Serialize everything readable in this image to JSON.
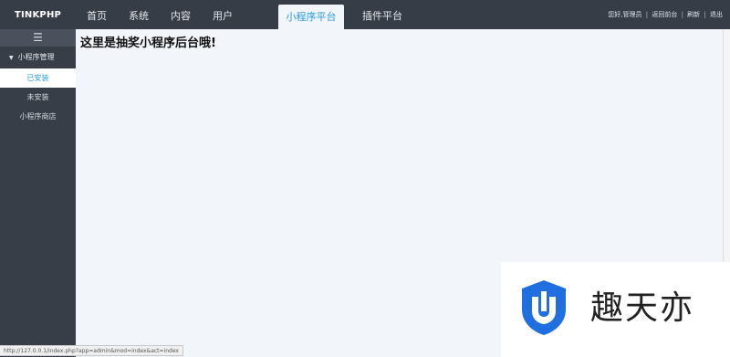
{
  "app": {
    "logo": "TINKPHP"
  },
  "nav": [
    {
      "label": "首页",
      "active": false,
      "width": 46
    },
    {
      "label": "系统",
      "active": false,
      "width": 46
    },
    {
      "label": "内容",
      "active": false,
      "width": 46
    },
    {
      "label": "用户",
      "active": false,
      "width": 46
    },
    {
      "label": "小程序平台",
      "active": true,
      "width": 72
    },
    {
      "label": "插件平台",
      "active": false,
      "width": 84
    }
  ],
  "userbar": {
    "greeting": "您好,管理员",
    "back_home": "返回前台",
    "refresh": "刷新",
    "logout": "退出",
    "separator": "|"
  },
  "sidebar": {
    "toggle_icon": "menu-icon",
    "group": {
      "label": "小程序管理",
      "expanded": true
    },
    "items": [
      {
        "label": "已安装",
        "active": true
      },
      {
        "label": "未安装",
        "active": false
      },
      {
        "label": "小程序商店",
        "active": false
      }
    ]
  },
  "main": {
    "heading": "这里是抽奖小程序后台哦!"
  },
  "statusbar": {
    "url": "http://127.0.0.1/index.php?app=admin&mod=index&act=index"
  },
  "watermark": {
    "text": "趣天亦",
    "logo_color": "#1f6fe0"
  },
  "colors": {
    "topbar": "#373d47",
    "sidebar": "#383e48",
    "accent": "#2a9de0",
    "main_bg": "#f2f5f9"
  }
}
